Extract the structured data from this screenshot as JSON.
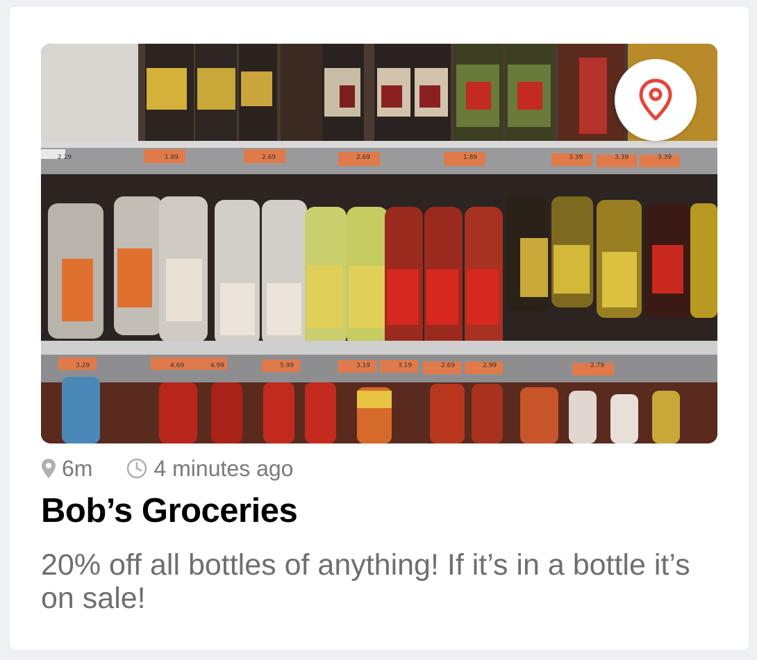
{
  "card": {
    "image_alt": "Store shelves with bottles",
    "distance": "6m",
    "time": "4 minutes ago",
    "title": "Bob’s Groceries",
    "description": "20% off all bottles of anything! If it’s in a bottle it’s on sale!",
    "pin_icon": "location-pin-icon",
    "accent_color": "#e8443a"
  },
  "shelf_prices": {
    "top": [
      "2.29",
      "1.89",
      "2.69",
      "2.69",
      "1.89",
      "3.39",
      "3.39",
      "3.39"
    ],
    "middle": [
      "3.29",
      "4.69",
      "4.99",
      "5.99",
      "3.19",
      "3.19",
      "2.69",
      "2.99",
      "2.79"
    ]
  }
}
